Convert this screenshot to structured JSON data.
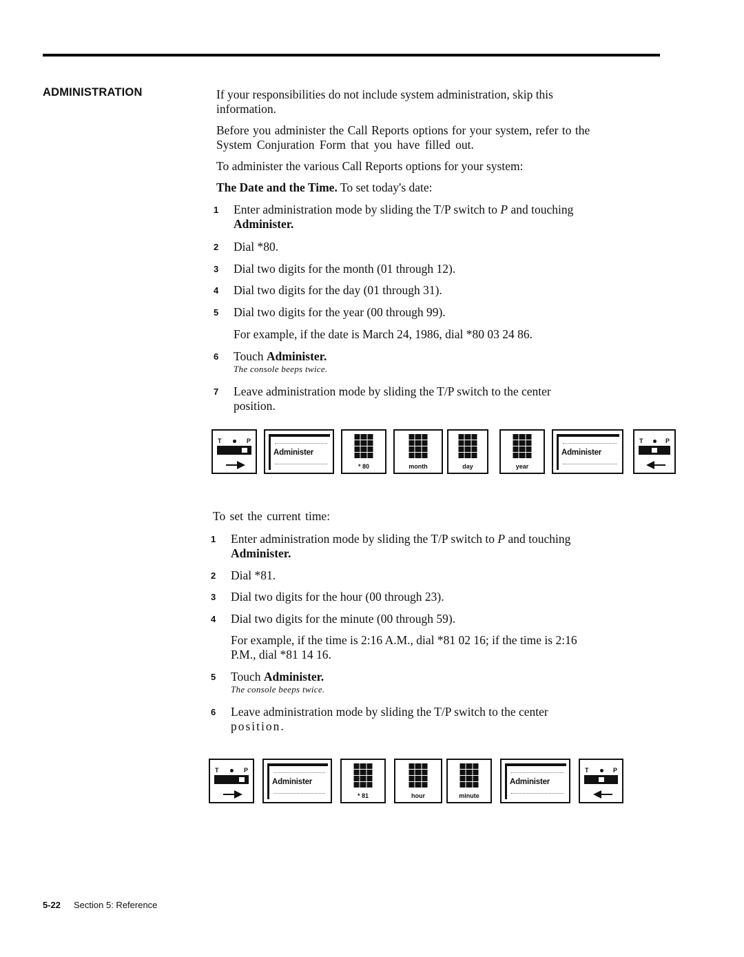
{
  "section_heading": "ADMINISTRATION",
  "intro": {
    "p1": "If your responsibilities do not include system administration, skip this",
    "p1b": "information.",
    "p2": "Before you administer the Call Reports options for your system, refer to the",
    "p2b": "System Conjuration Form that you have filled out.",
    "p3": "To administer the various Call Reports options for your system:",
    "subhead_bold": "The Date and the Time.",
    "subhead_rest": " To set today's date:"
  },
  "date_steps": [
    {
      "num": "1",
      "text": "Enter administration mode by sliding the T/P switch to ",
      "italic": "P",
      "text2": " and  touching",
      "bold_line": "Administer."
    },
    {
      "num": "2",
      "text": "Dial  *80."
    },
    {
      "num": "3",
      "text": "Dial two digits for the month (01 through 12)."
    },
    {
      "num": "4",
      "text": "Dial two digits for the day (01 through 31)."
    },
    {
      "num": "5",
      "text": "Dial two digits for the year (00 through 99)."
    },
    {
      "example": "For example, if the date is March 24, 1986, dial *80 03 24 86."
    },
    {
      "num": "6",
      "text": "Touch ",
      "bold": "Administer.",
      "note": "The console beeps twice."
    },
    {
      "num": "7",
      "text": "Leave administration mode by sliding the T/P switch to the center",
      "text_line2": "position."
    }
  ],
  "date_icons": [
    {
      "type": "tp-switch",
      "label_t": "T",
      "label_p": "P",
      "arrow": "right"
    },
    {
      "type": "administer",
      "label": "Administer"
    },
    {
      "type": "dialpad",
      "caption": "* 80"
    },
    {
      "type": "dialpad",
      "caption": "month"
    },
    {
      "type": "dialpad",
      "caption": "day"
    },
    {
      "type": "dialpad",
      "caption": "year"
    },
    {
      "type": "administer",
      "label": "Administer"
    },
    {
      "type": "tp-switch",
      "label_t": "T",
      "label_p": "P",
      "arrow": "left"
    }
  ],
  "time_intro": "To set the current time:",
  "time_steps": [
    {
      "num": "1",
      "text": "Enter administration mode by sliding the T/P switch to ",
      "italic": "P",
      "text2": " and  touching",
      "bold_line": "Administer."
    },
    {
      "num": "2",
      "text": "Dial  *81."
    },
    {
      "num": "3",
      "text": "Dial two digits for the hour (00 through 23)."
    },
    {
      "num": "4",
      "text": "Dial two digits for the minute (00 through 59)."
    },
    {
      "example": "For example, if the time is 2:16 A.M., dial *81 02 16; if the time is 2:16",
      "example_line2": "P.M., dial *81 14 16."
    },
    {
      "num": "5",
      "text": "Touch ",
      "bold": "Administer.",
      "note": "The console beeps twice."
    },
    {
      "num": "6",
      "text": "Leave administration mode by sliding the T/P switch to the center",
      "text_line2": "position."
    }
  ],
  "time_icons": [
    {
      "type": "tp-switch",
      "label_t": "T",
      "label_p": "P",
      "arrow": "right"
    },
    {
      "type": "administer",
      "label": "Administer"
    },
    {
      "type": "dialpad",
      "caption": "* 81"
    },
    {
      "type": "dialpad",
      "caption": "hour"
    },
    {
      "type": "dialpad",
      "caption": "minute"
    },
    {
      "type": "administer",
      "label": "Administer"
    },
    {
      "type": "tp-switch",
      "label_t": "T",
      "label_p": "P",
      "arrow": "left"
    }
  ],
  "footer": {
    "page_number": "5-22",
    "section": "Section 5: Reference"
  }
}
